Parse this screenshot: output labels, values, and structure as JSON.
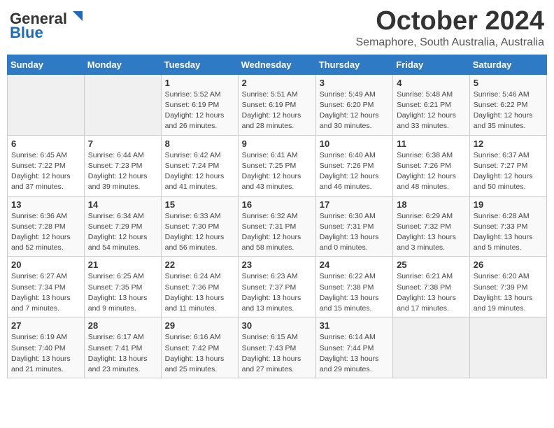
{
  "logo": {
    "line1": "General",
    "line2": "Blue"
  },
  "title": "October 2024",
  "subtitle": "Semaphore, South Australia, Australia",
  "days_of_week": [
    "Sunday",
    "Monday",
    "Tuesday",
    "Wednesday",
    "Thursday",
    "Friday",
    "Saturday"
  ],
  "weeks": [
    [
      {
        "day": "",
        "detail": ""
      },
      {
        "day": "",
        "detail": ""
      },
      {
        "day": "1",
        "detail": "Sunrise: 5:52 AM\nSunset: 6:19 PM\nDaylight: 12 hours and 26 minutes."
      },
      {
        "day": "2",
        "detail": "Sunrise: 5:51 AM\nSunset: 6:19 PM\nDaylight: 12 hours and 28 minutes."
      },
      {
        "day": "3",
        "detail": "Sunrise: 5:49 AM\nSunset: 6:20 PM\nDaylight: 12 hours and 30 minutes."
      },
      {
        "day": "4",
        "detail": "Sunrise: 5:48 AM\nSunset: 6:21 PM\nDaylight: 12 hours and 33 minutes."
      },
      {
        "day": "5",
        "detail": "Sunrise: 5:46 AM\nSunset: 6:22 PM\nDaylight: 12 hours and 35 minutes."
      }
    ],
    [
      {
        "day": "6",
        "detail": "Sunrise: 6:45 AM\nSunset: 7:22 PM\nDaylight: 12 hours and 37 minutes."
      },
      {
        "day": "7",
        "detail": "Sunrise: 6:44 AM\nSunset: 7:23 PM\nDaylight: 12 hours and 39 minutes."
      },
      {
        "day": "8",
        "detail": "Sunrise: 6:42 AM\nSunset: 7:24 PM\nDaylight: 12 hours and 41 minutes."
      },
      {
        "day": "9",
        "detail": "Sunrise: 6:41 AM\nSunset: 7:25 PM\nDaylight: 12 hours and 43 minutes."
      },
      {
        "day": "10",
        "detail": "Sunrise: 6:40 AM\nSunset: 7:26 PM\nDaylight: 12 hours and 46 minutes."
      },
      {
        "day": "11",
        "detail": "Sunrise: 6:38 AM\nSunset: 7:26 PM\nDaylight: 12 hours and 48 minutes."
      },
      {
        "day": "12",
        "detail": "Sunrise: 6:37 AM\nSunset: 7:27 PM\nDaylight: 12 hours and 50 minutes."
      }
    ],
    [
      {
        "day": "13",
        "detail": "Sunrise: 6:36 AM\nSunset: 7:28 PM\nDaylight: 12 hours and 52 minutes."
      },
      {
        "day": "14",
        "detail": "Sunrise: 6:34 AM\nSunset: 7:29 PM\nDaylight: 12 hours and 54 minutes."
      },
      {
        "day": "15",
        "detail": "Sunrise: 6:33 AM\nSunset: 7:30 PM\nDaylight: 12 hours and 56 minutes."
      },
      {
        "day": "16",
        "detail": "Sunrise: 6:32 AM\nSunset: 7:31 PM\nDaylight: 12 hours and 58 minutes."
      },
      {
        "day": "17",
        "detail": "Sunrise: 6:30 AM\nSunset: 7:31 PM\nDaylight: 13 hours and 0 minutes."
      },
      {
        "day": "18",
        "detail": "Sunrise: 6:29 AM\nSunset: 7:32 PM\nDaylight: 13 hours and 3 minutes."
      },
      {
        "day": "19",
        "detail": "Sunrise: 6:28 AM\nSunset: 7:33 PM\nDaylight: 13 hours and 5 minutes."
      }
    ],
    [
      {
        "day": "20",
        "detail": "Sunrise: 6:27 AM\nSunset: 7:34 PM\nDaylight: 13 hours and 7 minutes."
      },
      {
        "day": "21",
        "detail": "Sunrise: 6:25 AM\nSunset: 7:35 PM\nDaylight: 13 hours and 9 minutes."
      },
      {
        "day": "22",
        "detail": "Sunrise: 6:24 AM\nSunset: 7:36 PM\nDaylight: 13 hours and 11 minutes."
      },
      {
        "day": "23",
        "detail": "Sunrise: 6:23 AM\nSunset: 7:37 PM\nDaylight: 13 hours and 13 minutes."
      },
      {
        "day": "24",
        "detail": "Sunrise: 6:22 AM\nSunset: 7:38 PM\nDaylight: 13 hours and 15 minutes."
      },
      {
        "day": "25",
        "detail": "Sunrise: 6:21 AM\nSunset: 7:38 PM\nDaylight: 13 hours and 17 minutes."
      },
      {
        "day": "26",
        "detail": "Sunrise: 6:20 AM\nSunset: 7:39 PM\nDaylight: 13 hours and 19 minutes."
      }
    ],
    [
      {
        "day": "27",
        "detail": "Sunrise: 6:19 AM\nSunset: 7:40 PM\nDaylight: 13 hours and 21 minutes."
      },
      {
        "day": "28",
        "detail": "Sunrise: 6:17 AM\nSunset: 7:41 PM\nDaylight: 13 hours and 23 minutes."
      },
      {
        "day": "29",
        "detail": "Sunrise: 6:16 AM\nSunset: 7:42 PM\nDaylight: 13 hours and 25 minutes."
      },
      {
        "day": "30",
        "detail": "Sunrise: 6:15 AM\nSunset: 7:43 PM\nDaylight: 13 hours and 27 minutes."
      },
      {
        "day": "31",
        "detail": "Sunrise: 6:14 AM\nSunset: 7:44 PM\nDaylight: 13 hours and 29 minutes."
      },
      {
        "day": "",
        "detail": ""
      },
      {
        "day": "",
        "detail": ""
      }
    ]
  ]
}
